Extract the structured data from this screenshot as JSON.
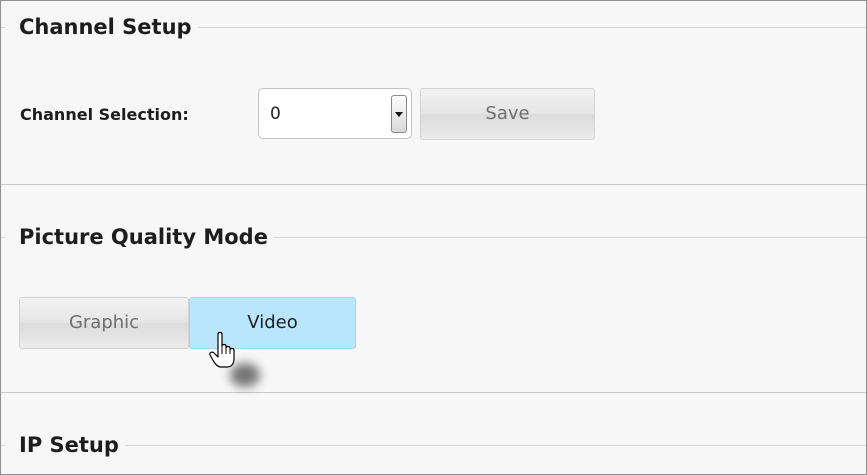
{
  "channel_setup": {
    "title": "Channel Setup",
    "selection_label": "Channel Selection:",
    "selected_channel": "0",
    "save_label": "Save"
  },
  "picture_quality": {
    "title": "Picture Quality Mode",
    "modes": [
      "Graphic",
      "Video"
    ],
    "active_mode": "Video"
  },
  "ip_setup": {
    "title": "IP Setup"
  },
  "colors": {
    "active_mode_bg": "#b9e6fc",
    "panel_bg": "#f7f7f7"
  },
  "icons": {
    "select_arrow": "chevron-down-icon",
    "pointer": "hand-pointer-cursor-icon"
  }
}
